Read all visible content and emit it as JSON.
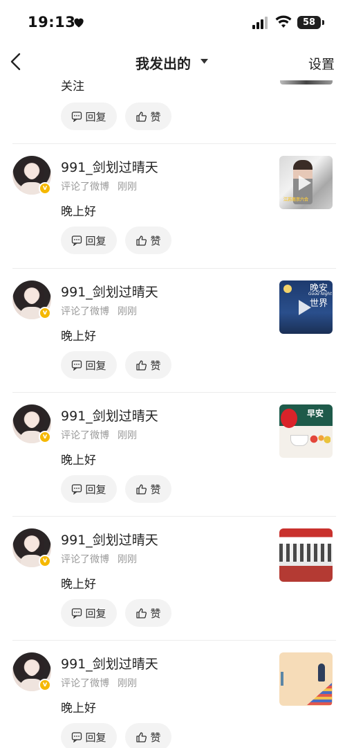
{
  "status_bar": {
    "time": "19:13",
    "battery": "58"
  },
  "nav": {
    "title": "我发出的",
    "settings": "设置"
  },
  "partial_card": {
    "text": "关注",
    "reply_label": "回复",
    "like_label": "赞"
  },
  "cards": [
    {
      "username": "991_剑划过晴天",
      "action": "评论了微博",
      "time": "刚刚",
      "content": "晚上好",
      "reply_label": "回复",
      "like_label": "赞",
      "thumb_caption": "江苏南京六合"
    },
    {
      "username": "991_剑划过晴天",
      "action": "评论了微博",
      "time": "刚刚",
      "content": "晚上好",
      "reply_label": "回复",
      "like_label": "赞",
      "thumb_title_1": "晚安",
      "thumb_subtitle": "Good Night",
      "thumb_title_2": "世界"
    },
    {
      "username": "991_剑划过晴天",
      "action": "评论了微博",
      "time": "刚刚",
      "content": "晚上好",
      "reply_label": "回复",
      "like_label": "赞",
      "thumb_title": "早安"
    },
    {
      "username": "991_剑划过晴天",
      "action": "评论了微博",
      "time": "刚刚",
      "content": "晚上好",
      "reply_label": "回复",
      "like_label": "赞"
    },
    {
      "username": "991_剑划过晴天",
      "action": "评论了微博",
      "time": "刚刚",
      "content": "晚上好",
      "reply_label": "回复",
      "like_label": "赞"
    }
  ],
  "colors": {
    "verified_badge": "#f5b800",
    "pill_bg": "#f3f3f3",
    "meta_text": "#9a9a9a"
  }
}
